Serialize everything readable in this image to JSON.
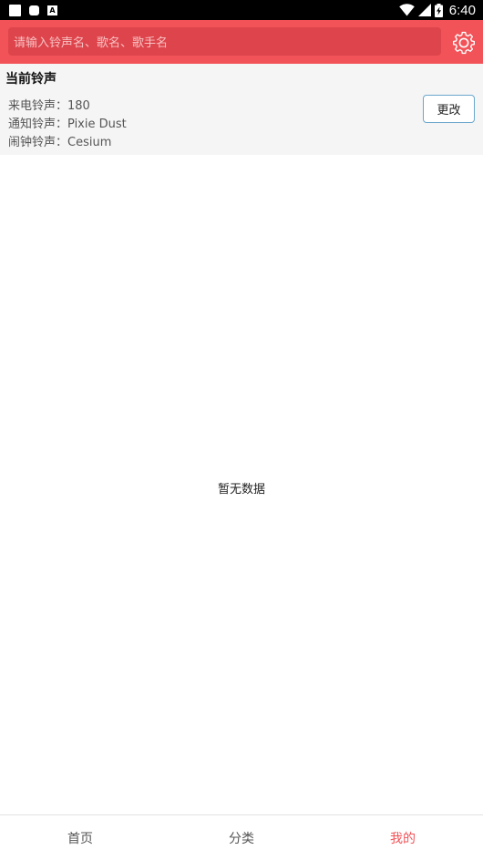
{
  "status_bar": {
    "time": "6:40",
    "icons": [
      "notification-square-icon",
      "notification-round-icon",
      "a-app-icon",
      "wifi-icon",
      "cell-signal-icon",
      "battery-charging-icon"
    ],
    "notification_glyph": "A"
  },
  "header": {
    "search_placeholder": "请输入铃声名、歌名、歌手名",
    "settings_icon": "gear-icon",
    "colors": {
      "background": "#f25359",
      "search_background": "#de444b"
    }
  },
  "current_ringtones": {
    "title": "当前铃声",
    "items": [
      {
        "label": "来电铃声：",
        "value": "180"
      },
      {
        "label": "通知铃声：",
        "value": "Pixie Dust"
      },
      {
        "label": "闹钟铃声：",
        "value": "Cesium"
      }
    ],
    "change_button": "更改"
  },
  "empty_state": {
    "text": "暂无数据"
  },
  "bottom_nav": {
    "items": [
      {
        "label": "首页",
        "active": false
      },
      {
        "label": "分类",
        "active": false
      },
      {
        "label": "我的",
        "active": true
      }
    ],
    "active_color": "#f25359"
  }
}
